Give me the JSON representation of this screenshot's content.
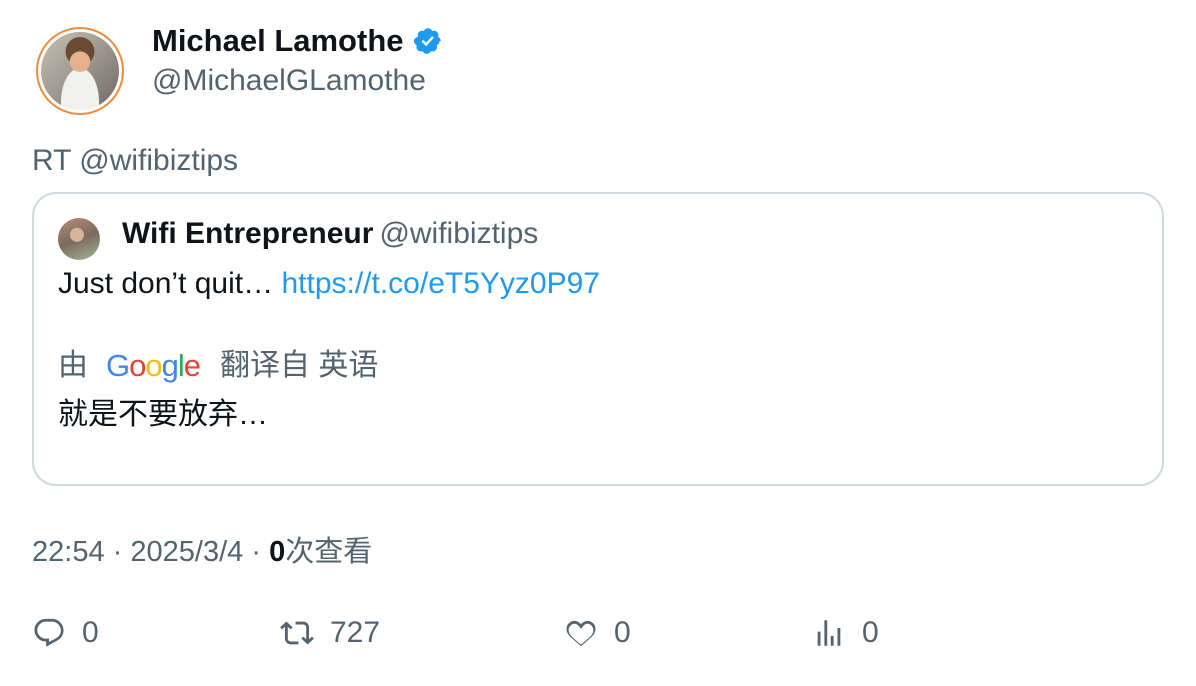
{
  "author": {
    "name": "Michael Lamothe",
    "handle": "@MichaelGLamothe"
  },
  "tweet": {
    "text": "RT @wifibiztips"
  },
  "quoted": {
    "name": "Wifi Entrepreneur",
    "handle": "@wifibiztips",
    "text": "Just don’t quit…",
    "link": "https://t.co/eT5Yyz0P97",
    "translation": {
      "prefix": "由",
      "brand": "Google",
      "suffix": "翻译自 英语",
      "text": "就是不要放弃…"
    }
  },
  "meta": {
    "time": "22:54",
    "date": "2025/3/4",
    "views_count": "0",
    "views_label": "次查看",
    "separator": "·"
  },
  "actions": {
    "replies": "0",
    "retweets": "727",
    "likes": "0",
    "views": "0"
  },
  "colors": {
    "accent": "#1d9bf0",
    "secondary_text": "#536471",
    "border": "#cfd9de"
  },
  "icons": [
    "verified-badge-icon",
    "reply-icon",
    "retweet-icon",
    "like-icon",
    "views-icon",
    "google-logo"
  ]
}
